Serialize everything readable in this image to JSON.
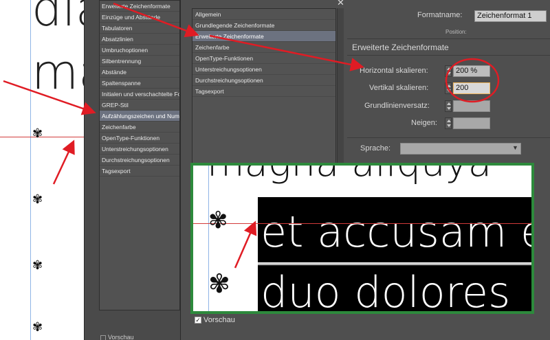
{
  "document_left": {
    "text_line1": "dia",
    "text_line2": "ma",
    "bullet_glyph": "✾"
  },
  "dialog_back": {
    "list_items": [
      {
        "label": "Erweiterte Zeichenformate",
        "selected": false
      },
      {
        "label": "Einzüge und Abstände",
        "selected": false
      },
      {
        "label": "Tabulatoren",
        "selected": false
      },
      {
        "label": "Absatzlinien",
        "selected": false
      },
      {
        "label": "Umbruchoptionen",
        "selected": false
      },
      {
        "label": "Silbentrennung",
        "selected": false
      },
      {
        "label": "Abstände",
        "selected": false
      },
      {
        "label": "Spaltenspanne",
        "selected": false
      },
      {
        "label": "Initialen und verschachtelte Formate",
        "selected": false
      },
      {
        "label": "GREP-Stil",
        "selected": false
      },
      {
        "label": "Aufzählungszeichen und Nummerierung",
        "selected": true
      },
      {
        "label": "Zeichenfarbe",
        "selected": false
      },
      {
        "label": "OpenType-Funktionen",
        "selected": false
      },
      {
        "label": "Unterstreichungsoptionen",
        "selected": false
      },
      {
        "label": "Durchstreichungsoptionen",
        "selected": false
      },
      {
        "label": "Tagsexport",
        "selected": false
      }
    ],
    "preview_label": "Vorschau"
  },
  "dialog_front": {
    "list_items": [
      {
        "label": "Allgemein",
        "selected": false
      },
      {
        "label": "Grundlegende Zeichenformate",
        "selected": false
      },
      {
        "label": "Erweiterte Zeichenformate",
        "selected": true
      },
      {
        "label": "Zeichenfarbe",
        "selected": false
      },
      {
        "label": "OpenType-Funktionen",
        "selected": false
      },
      {
        "label": "Unterstreichungsoptionen",
        "selected": false
      },
      {
        "label": "Durchstreichungsoptionen",
        "selected": false
      },
      {
        "label": "Tagsexport",
        "selected": false
      }
    ],
    "formatname_label": "Formatname:",
    "formatname_value": "Zeichenformat 1",
    "position_label": "Position:",
    "section_title": "Erweiterte Zeichenformate",
    "horizontal_label": "Horizontal skalieren:",
    "horizontal_value": "200 %",
    "vertical_label": "Vertikal skalieren:",
    "vertical_value": "200",
    "baseline_label": "Grundlinienversatz:",
    "baseline_value": "",
    "skew_label": "Neigen:",
    "skew_value": "",
    "language_label": "Sprache:",
    "language_value": "",
    "preview_label": "Vorschau",
    "preview_checked": true
  },
  "zoom_preview": {
    "top_text": "magna aliquya",
    "line1": "et accusam e",
    "line2": "duo dolores"
  },
  "colors": {
    "annotation_red": "#e01c24",
    "zoom_border": "#2d8a3c",
    "selection": "#6c7280"
  }
}
